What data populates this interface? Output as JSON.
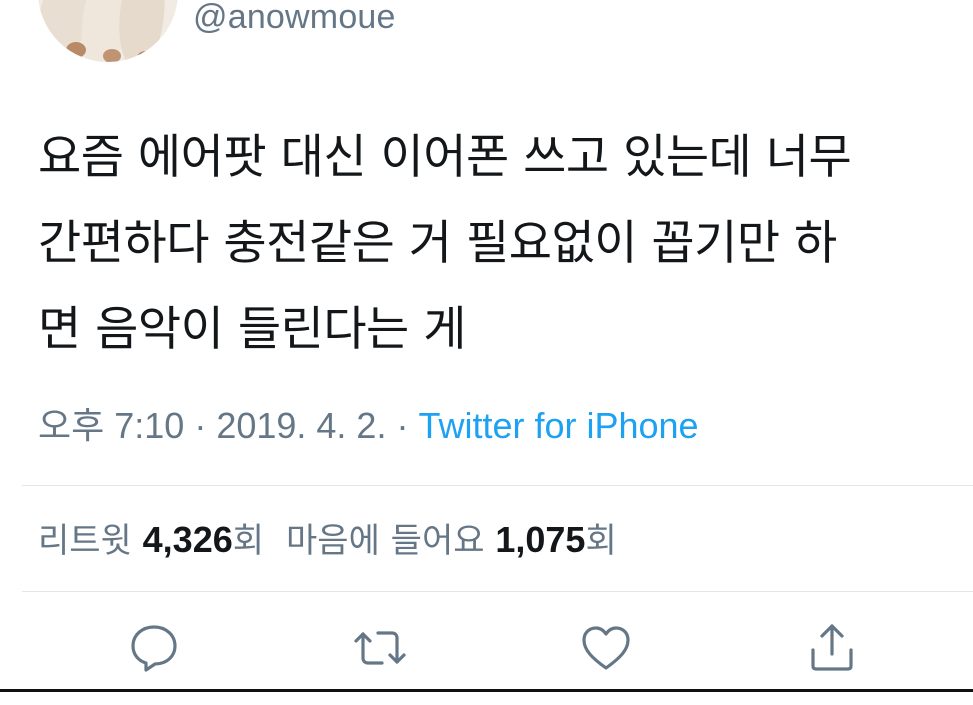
{
  "author": {
    "handle": "@anowmoue",
    "avatar_icon": "avatar-photo"
  },
  "tweet": {
    "lines": [
      "요즘 에어팟 대신 이어폰 쓰고 있는데 너무",
      "간편하다 충전같은 거 필요없이 꼽기만 하",
      "면 음악이 들린다는 게"
    ]
  },
  "meta": {
    "time": "오후 7:10",
    "separator": " · ",
    "date": "2019. 4. 2.",
    "source": "Twitter for iPhone"
  },
  "stats": {
    "retweets_label": "리트윗",
    "retweets_count": "4,326",
    "retweets_unit": "회",
    "likes_label": "마음에 들어요",
    "likes_count": "1,075",
    "likes_unit": "회"
  },
  "actions": [
    {
      "name": "reply",
      "icon": "speech-bubble-icon"
    },
    {
      "name": "retweet",
      "icon": "retweet-icon"
    },
    {
      "name": "like",
      "icon": "heart-icon"
    },
    {
      "name": "share",
      "icon": "share-icon"
    }
  ],
  "colors": {
    "text": "#14171a",
    "secondary": "#657786",
    "link": "#1da1f2",
    "divider": "#e1e8ed"
  }
}
